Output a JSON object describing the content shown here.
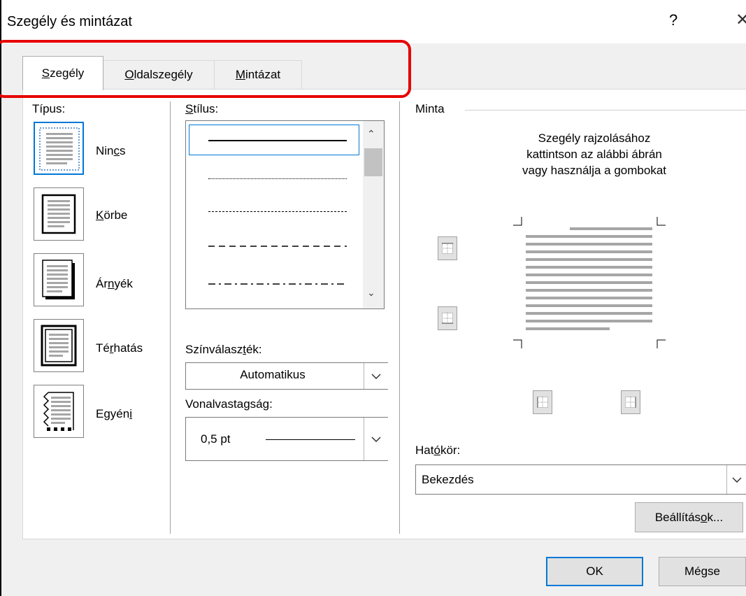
{
  "window": {
    "title": "Szegély és mintázat",
    "help": "?",
    "close": "✕"
  },
  "tabs": [
    {
      "label": "Szegély",
      "accel": "S",
      "rest": "zegély"
    },
    {
      "label": "Oldalszegély",
      "accel": "O",
      "rest": "ldalszegély"
    },
    {
      "label": "Mintázat",
      "accel": "M",
      "rest": "intázat"
    }
  ],
  "type_section": {
    "label": "Típus:",
    "items": [
      {
        "pre": "Nin",
        "accel": "c",
        "post": "s"
      },
      {
        "pre": "",
        "accel": "K",
        "post": "örbe"
      },
      {
        "pre": "Ár",
        "accel": "n",
        "post": "yék"
      },
      {
        "pre": "Té",
        "accel": "r",
        "post": "hatás"
      },
      {
        "pre": "Egyén",
        "accel": "i",
        "post": ""
      }
    ]
  },
  "style_section": {
    "label_accel": "S",
    "label_rest": "tílus:",
    "color_label_pre": "Színválasz",
    "color_label_accel": "t",
    "color_label_post": "ék:",
    "color_value": "Automatikus",
    "width_label_pre": "Vonalvasta",
    "width_label_accel": "g",
    "width_label_post": "ság:",
    "width_value": "0,5 pt"
  },
  "preview": {
    "label": "Minta",
    "instructions": [
      "Szegély rajzolásához",
      "kattintson az alábbi ábrán",
      "vagy használja a gombokat"
    ]
  },
  "scope": {
    "label_pre": "Hat",
    "label_accel": "ó",
    "label_post": "kör:",
    "value": "Bekezdés"
  },
  "buttons": {
    "options_pre": "Beállítás",
    "options_accel": "o",
    "options_post": "k...",
    "ok": "OK",
    "cancel": "Mégse"
  },
  "colors": {
    "highlight": "#e60000",
    "selected_border": "#0078d7",
    "dialog_bg": "#f0f0f0"
  }
}
